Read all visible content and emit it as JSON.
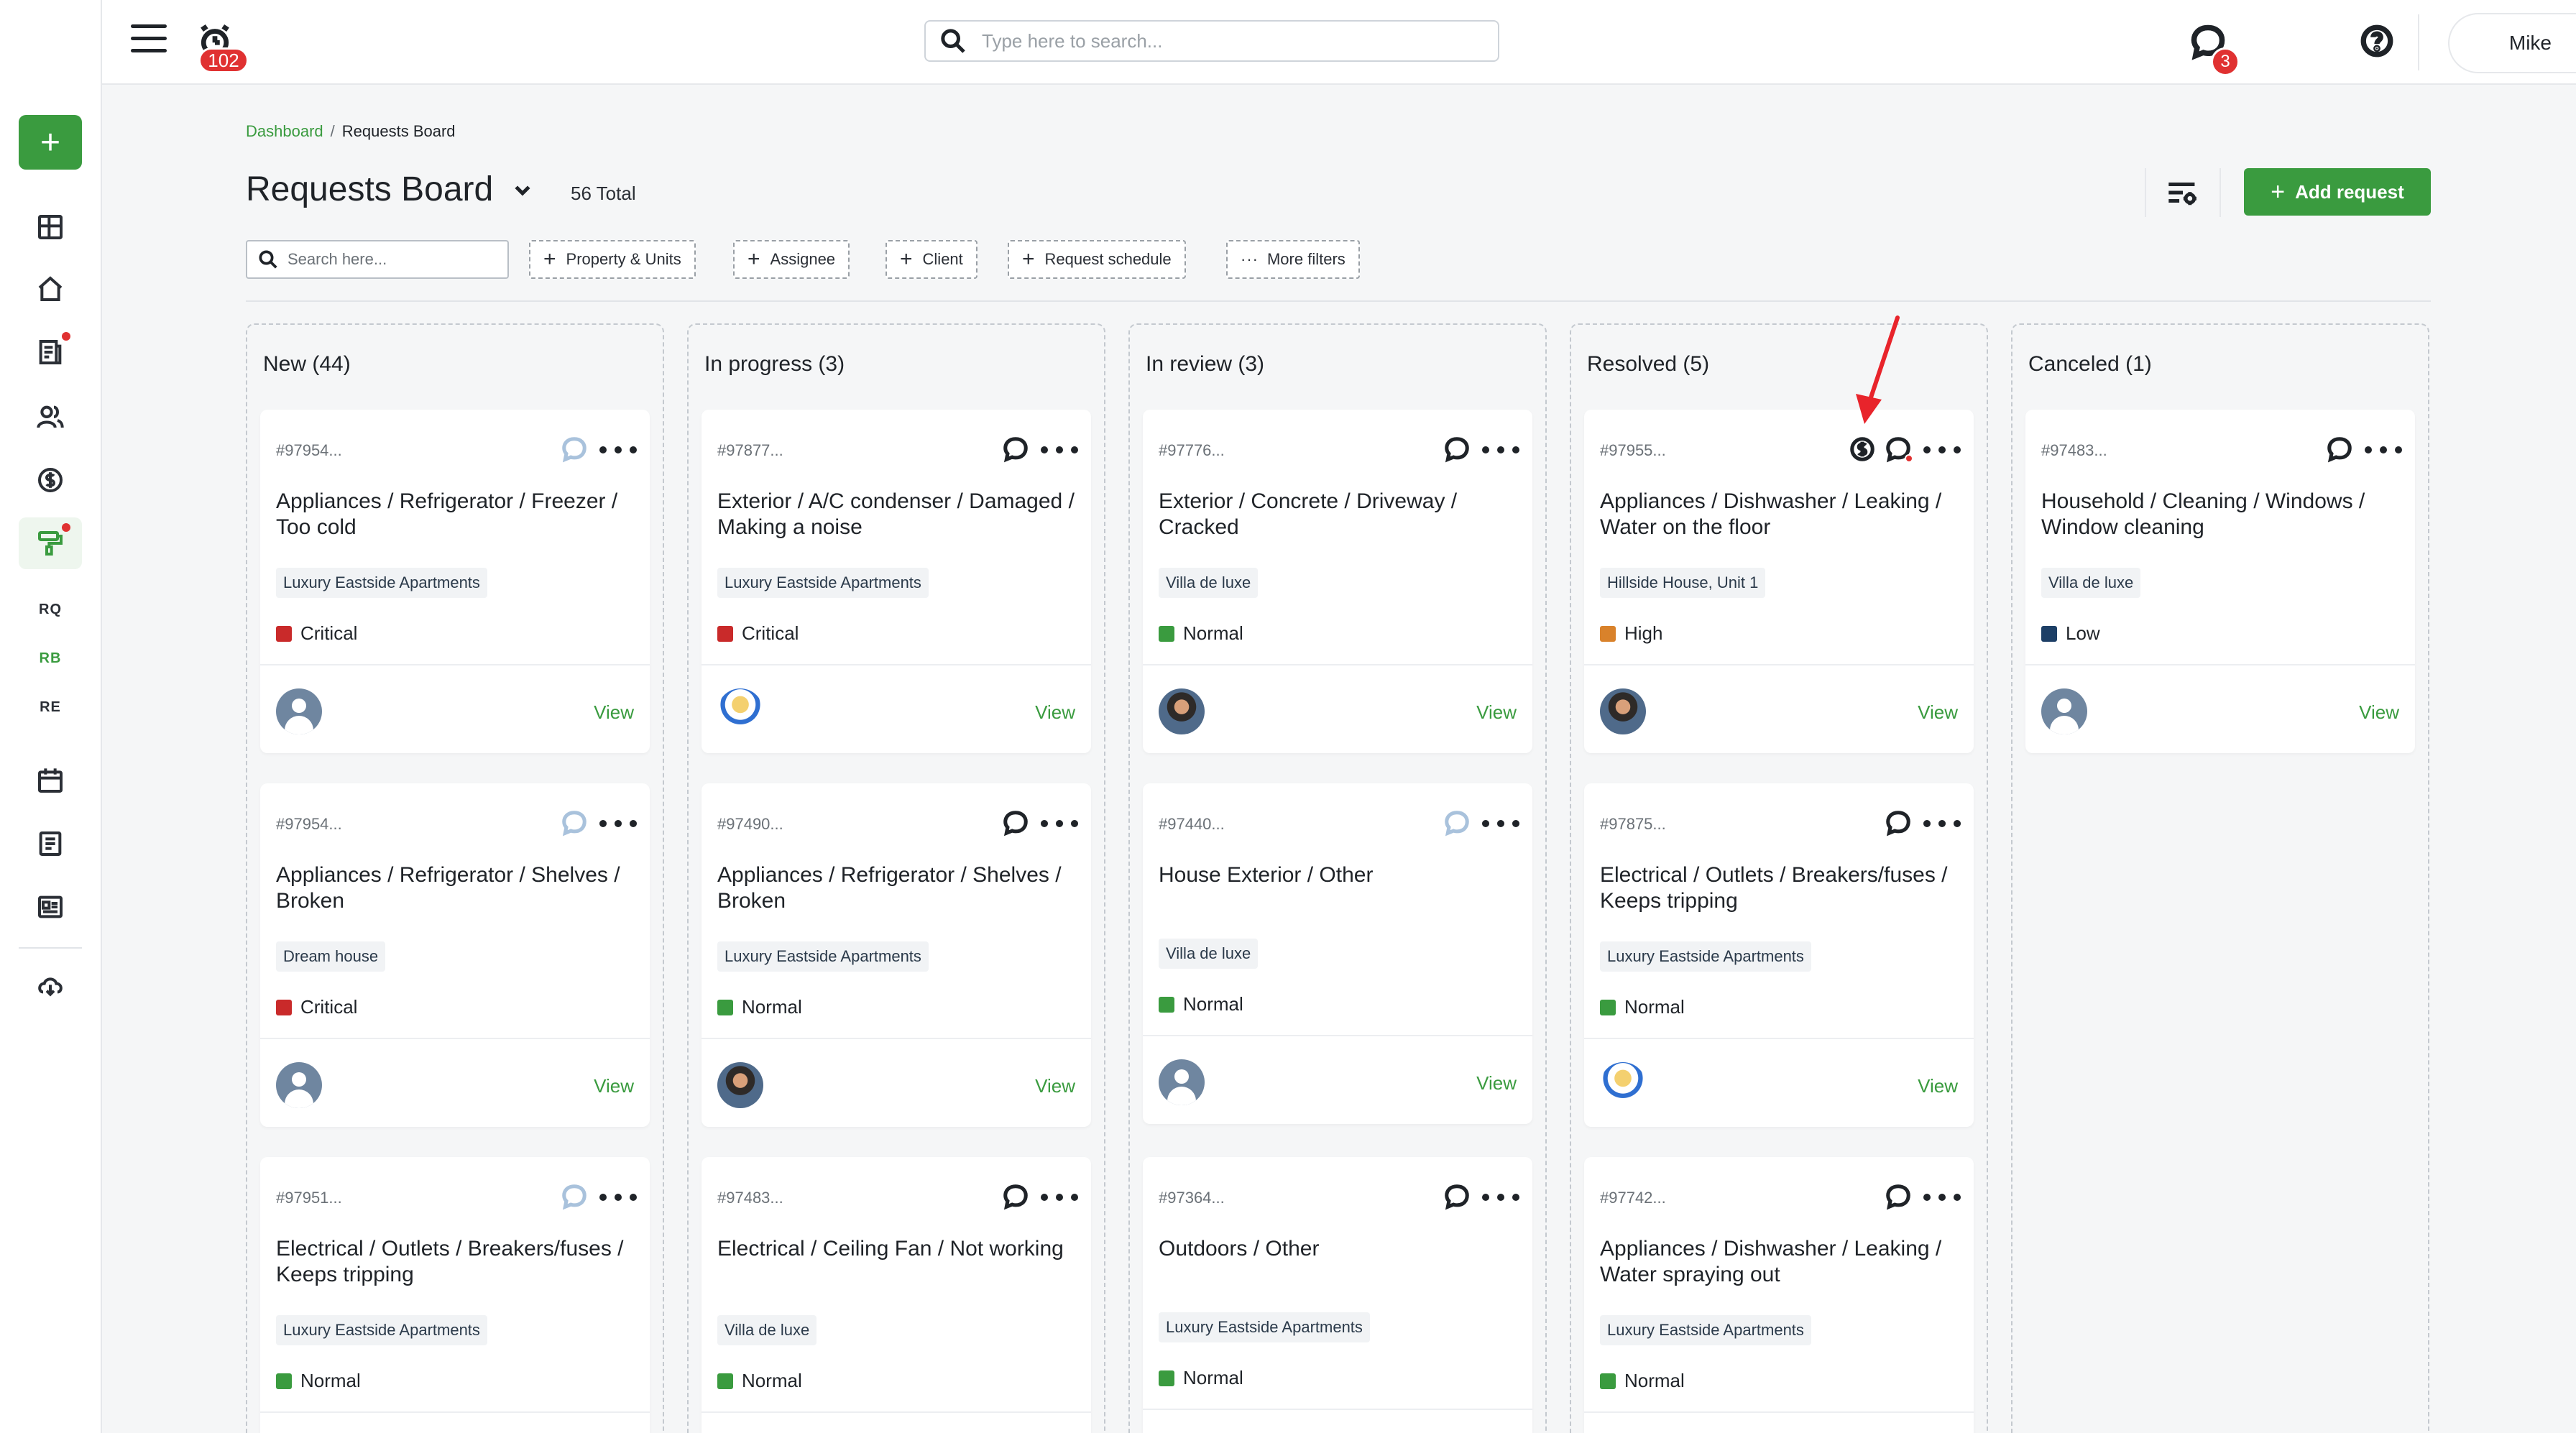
{
  "topbar": {
    "alarm_count": "102",
    "search_placeholder": "Type here to search...",
    "chat_count": "3",
    "user_name": "Mike"
  },
  "sidebar": {
    "items": [
      {
        "name": "dashboard-icon"
      },
      {
        "name": "home-icon"
      },
      {
        "name": "reports-icon"
      },
      {
        "name": "users-icon"
      },
      {
        "name": "dollar-icon"
      },
      {
        "name": "paint-roller-icon"
      },
      {
        "name": "calendar-icon"
      },
      {
        "name": "document-icon"
      },
      {
        "name": "list-card-icon"
      },
      {
        "name": "download-icon"
      }
    ],
    "shortcuts": [
      "RQ",
      "RB",
      "RE"
    ]
  },
  "breadcrumb": {
    "parent": "Dashboard",
    "separator": "/",
    "current": "Requests Board"
  },
  "header": {
    "title": "Requests Board",
    "total": "56 Total",
    "add_label": "Add request"
  },
  "filters": {
    "search_placeholder": "Search here...",
    "property": "Property & Units",
    "assignee": "Assignee",
    "client": "Client",
    "schedule": "Request schedule",
    "more": "More filters"
  },
  "colors": {
    "accent": "#3a9b3f",
    "critical": "#c92a2a",
    "high": "#d9822b",
    "normal": "#3a9b3f",
    "low": "#1d3f66"
  },
  "columns": [
    {
      "title": "New (44)",
      "cards": [
        {
          "id": "#97954...",
          "title": "Appliances / Refrigerator / Freezer / Too cold",
          "property": "Luxury Eastside Apartments",
          "priority": "Critical",
          "view": "View"
        },
        {
          "id": "#97954...",
          "title": "Appliances / Refrigerator / Shelves / Broken",
          "property": "Dream house",
          "priority": "Critical",
          "view": "View"
        },
        {
          "id": "#97951...",
          "title": "Electrical / Outlets / Breakers/fuses / Keeps tripping",
          "property": "Luxury Eastside Apartments",
          "priority": "Normal",
          "view": "View"
        }
      ]
    },
    {
      "title": "In progress (3)",
      "cards": [
        {
          "id": "#97877...",
          "title": "Exterior / A/C condenser / Damaged / Making a noise",
          "property": "Luxury Eastside Apartments",
          "priority": "Critical",
          "view": "View"
        },
        {
          "id": "#97490...",
          "title": "Appliances / Refrigerator / Shelves / Broken",
          "property": "Luxury Eastside Apartments",
          "priority": "Normal",
          "view": "View"
        },
        {
          "id": "#97483...",
          "title": "Electrical / Ceiling Fan / Not working",
          "property": "Villa de luxe",
          "priority": "Normal",
          "view": "View"
        }
      ]
    },
    {
      "title": "In review (3)",
      "cards": [
        {
          "id": "#97776...",
          "title": "Exterior / Concrete / Driveway / Cracked",
          "property": "Villa de luxe",
          "priority": "Normal",
          "view": "View"
        },
        {
          "id": "#97440...",
          "title": "House Exterior / Other",
          "property": "Villa de luxe",
          "priority": "Normal",
          "view": "View"
        },
        {
          "id": "#97364...",
          "title": "Outdoors / Other",
          "property": "Luxury Eastside Apartments",
          "priority": "Normal",
          "view": "View"
        }
      ]
    },
    {
      "title": "Resolved (5)",
      "cards": [
        {
          "id": "#97955...",
          "title": "Appliances / Dishwasher / Leaking / Water on the floor",
          "property": "Hillside House, Unit 1",
          "priority": "High",
          "view": "View"
        },
        {
          "id": "#97875...",
          "title": "Electrical / Outlets / Breakers/fuses / Keeps tripping",
          "property": "Luxury Eastside Apartments",
          "priority": "Normal",
          "view": "View"
        },
        {
          "id": "#97742...",
          "title": "Appliances / Dishwasher / Leaking / Water spraying out",
          "property": "Luxury Eastside Apartments",
          "priority": "Normal",
          "view": "View"
        }
      ]
    },
    {
      "title": "Canceled (1)",
      "cards": [
        {
          "id": "#97483...",
          "title": "Household / Cleaning / Windows / Window cleaning",
          "property": "Villa de luxe",
          "priority": "Low",
          "view": "View"
        }
      ]
    }
  ]
}
